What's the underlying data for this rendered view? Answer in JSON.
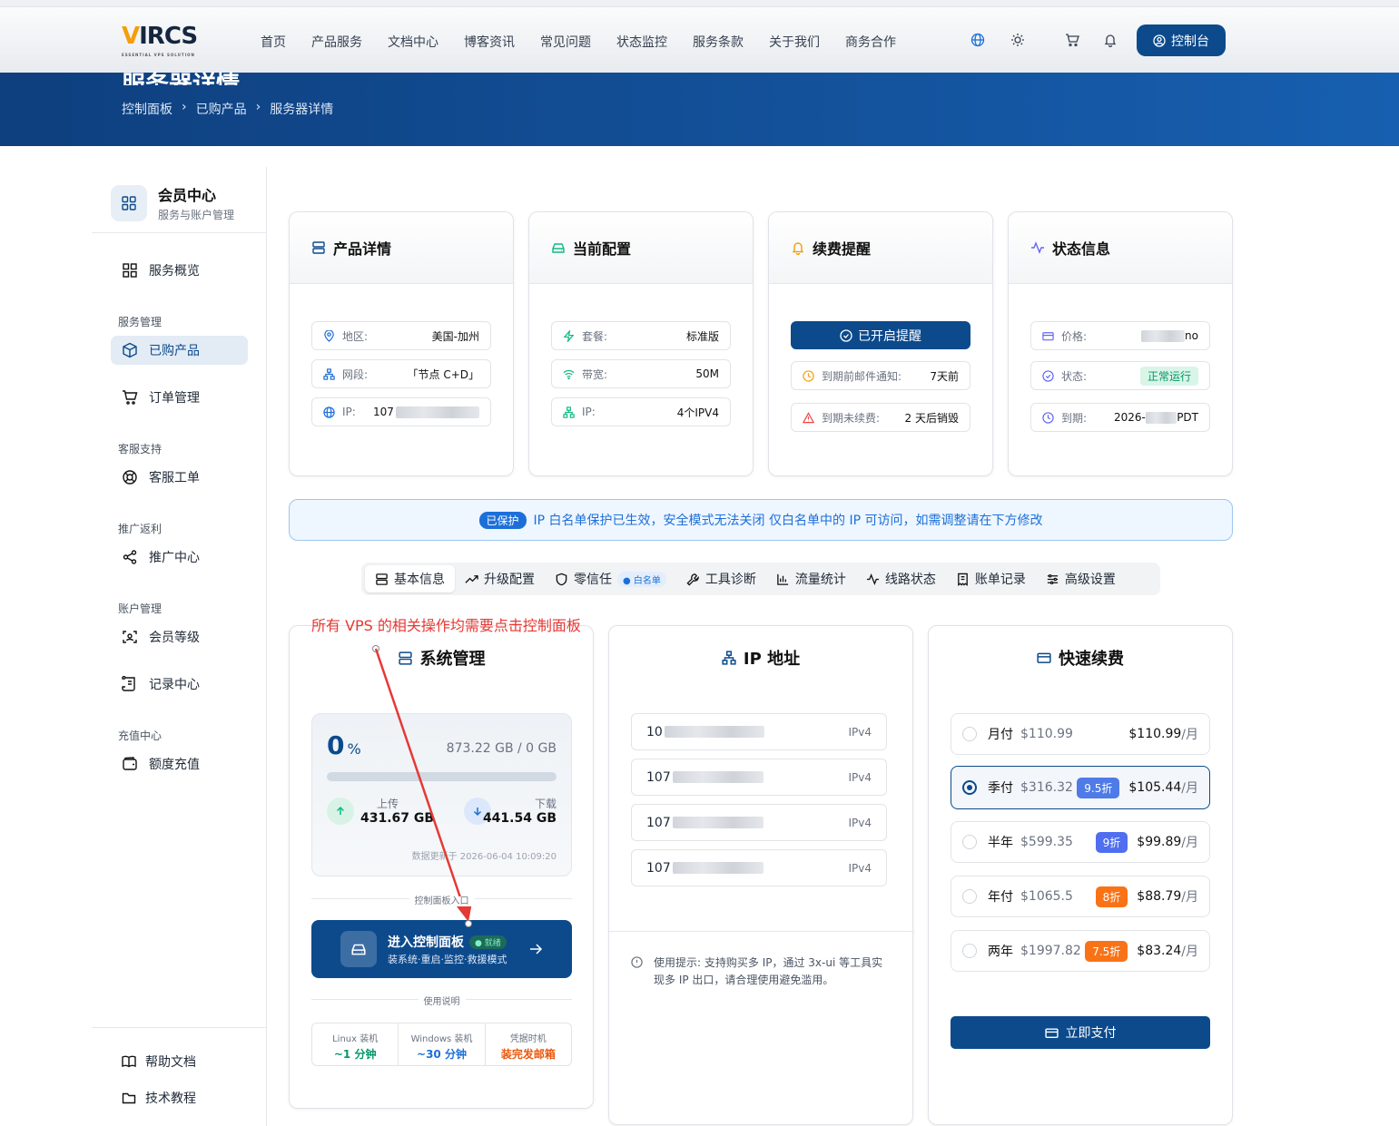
{
  "nav": {
    "logo": "IRCS",
    "logo_v": "V",
    "logo_sub": "ESSENTIAL VPS SOLUTION",
    "links": [
      "首页",
      "产品服务",
      "文档中心",
      "博客资讯",
      "常见问题",
      "状态监控",
      "服务条款",
      "关于我们",
      "商务合作"
    ],
    "console_label": "控制台"
  },
  "hero": {
    "title": "服务器详情",
    "crumbs": [
      "控制面板",
      "已购产品",
      "服务器详情"
    ]
  },
  "sidebar": {
    "member_title": "会员中心",
    "member_sub": "服务与账户管理",
    "overview": "服务概览",
    "group_service": "服务管理",
    "purchased": "已购产品",
    "orders": "订单管理",
    "group_support": "客服支持",
    "tickets": "客服工单",
    "group_promo": "推广返利",
    "promo_center": "推广中心",
    "group_account": "账户管理",
    "member_level": "会员等级",
    "records": "记录中心",
    "group_recharge": "充值中心",
    "recharge": "额度充值",
    "help_docs": "帮助文档",
    "tutorials": "技术教程"
  },
  "product": {
    "title": "产品详情",
    "region_label": "地区:",
    "region": "美国-加州",
    "segment_label": "网段:",
    "segment": "「节点 C+D」",
    "ip_label": "IP:",
    "ip": "107"
  },
  "config": {
    "title": "当前配置",
    "plan_label": "套餐:",
    "plan": "标准版",
    "bw_label": "带宽:",
    "bw": "50M",
    "ip_label": "IP:",
    "ip": "4个IPV4"
  },
  "renew": {
    "title": "续费提醒",
    "enabled": "已开启提醒",
    "email_label": "到期前邮件通知:",
    "email": "7天前",
    "destroy_label": "到期未续费:",
    "destroy": "2 天后销毁"
  },
  "status": {
    "title": "状态信息",
    "price_label": "价格:",
    "price_tail": "no",
    "state_label": "状态:",
    "state": "正常运行",
    "expire_label": "到期:",
    "expire_head": "2026-",
    "expire_tail": "PDT"
  },
  "notice": {
    "badge": "已保护",
    "text": "IP 白名单保护已生效，安全模式无法关闭  仅白名单中的 IP 可访问，如需调整请在下方修改"
  },
  "tabs": {
    "basic": "基本信息",
    "upgrade": "升级配置",
    "zerotrust": "零信任",
    "whitelist": "白名单",
    "tools": "工具诊断",
    "traffic": "流量统计",
    "route": "线路状态",
    "billing": "账单记录",
    "advanced": "高级设置"
  },
  "annotation": "所有 VPS 的相关操作均需要点击控制面板",
  "system": {
    "title": "系统管理",
    "percent": "0",
    "percent_unit": "%",
    "usage": "873.22 GB / 0 GB",
    "usage_fraction": 0,
    "upload_label": "上传",
    "upload": "431.67 GB",
    "download_label": "下载",
    "download": "441.54 GB",
    "updated": "数据更新于 2026-06-04 10:09:20",
    "panel_entry": "控制面板入口",
    "enter_title": "进入控制面板",
    "enter_badge": "就绪",
    "enter_sub": "装系统·重启·监控·救援模式",
    "usage_note": "使用说明",
    "linux_label": "Linux 装机",
    "linux": "~1 分钟",
    "windows_label": "Windows 装机",
    "windows": "~30 分钟",
    "cred_label": "凭据时机",
    "cred": "装完发邮箱"
  },
  "ips": {
    "title": "IP 地址",
    "rows": [
      {
        "prefix": "10",
        "type": "IPv4"
      },
      {
        "prefix": "107",
        "type": "IPv4"
      },
      {
        "prefix": "107",
        "type": "IPv4"
      },
      {
        "prefix": "107",
        "type": "IPv4"
      }
    ],
    "tip_label": "使用提示:",
    "tip": "支持购买多 IP，通过 3x-ui 等工具实现多 IP 出口，请合理使用避免滥用。"
  },
  "quick": {
    "title": "快速续费",
    "plans": [
      {
        "name": "月付",
        "orig": "$110.99",
        "disc": "",
        "price": "$110.99",
        "unit": "/月"
      },
      {
        "name": "季付",
        "orig": "$316.32",
        "disc": "9.5折",
        "price": "$105.44",
        "unit": "/月"
      },
      {
        "name": "半年",
        "orig": "$599.35",
        "disc": "9折",
        "price": "$99.89",
        "unit": "/月"
      },
      {
        "name": "年付",
        "orig": "$1065.5",
        "disc": "8折",
        "price": "$88.79",
        "unit": "/月"
      },
      {
        "name": "两年",
        "orig": "$1997.82",
        "disc": "7.5折",
        "price": "$83.24",
        "unit": "/月"
      }
    ],
    "pay": "立即支付"
  },
  "colors": {
    "primary": "#0c4a8c",
    "green": "#10b981",
    "annot": "#e53935"
  }
}
